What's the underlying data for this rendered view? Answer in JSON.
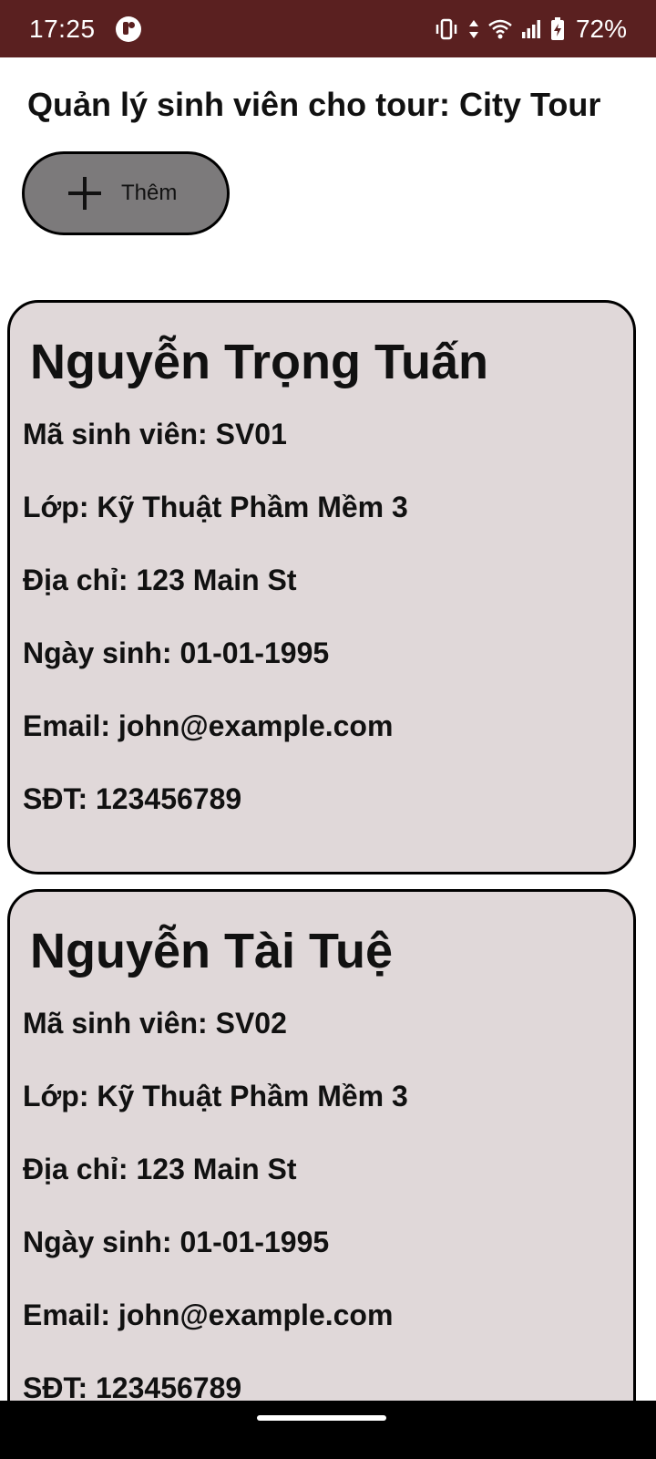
{
  "status_bar": {
    "time": "17:25",
    "battery": "72%",
    "icons": [
      "app-icon",
      "vibrate-icon",
      "data-arrows-icon",
      "wifi-icon",
      "signal-icon",
      "battery-icon"
    ]
  },
  "page": {
    "title": "Quản lý sinh viên cho tour: City Tour"
  },
  "add_button": {
    "label": "Thêm",
    "icon": "plus-icon"
  },
  "students": [
    {
      "name": "Nguyễn Trọng Tuấn",
      "student_id": "Mã sinh viên: SV01",
      "class": "Lớp: Kỹ Thuật Phầm Mềm 3",
      "address": "Địa chỉ: 123 Main St",
      "birthday": "Ngày sinh: 01-01-1995",
      "email": "Email: john@example.com",
      "phone": "SĐT: 123456789"
    },
    {
      "name": "Nguyễn Tài Tuệ",
      "student_id": "Mã sinh viên: SV02",
      "class": "Lớp: Kỹ Thuật Phầm Mềm 3",
      "address": "Địa chỉ: 123 Main St",
      "birthday": "Ngày sinh: 01-01-1995",
      "email": "Email: john@example.com",
      "phone": "SĐT: 123456789"
    }
  ],
  "colors": {
    "status_bar": "#5a2020",
    "card_background": "#e0d8d9",
    "button_background": "#7c7a7b",
    "border": "#000000"
  }
}
